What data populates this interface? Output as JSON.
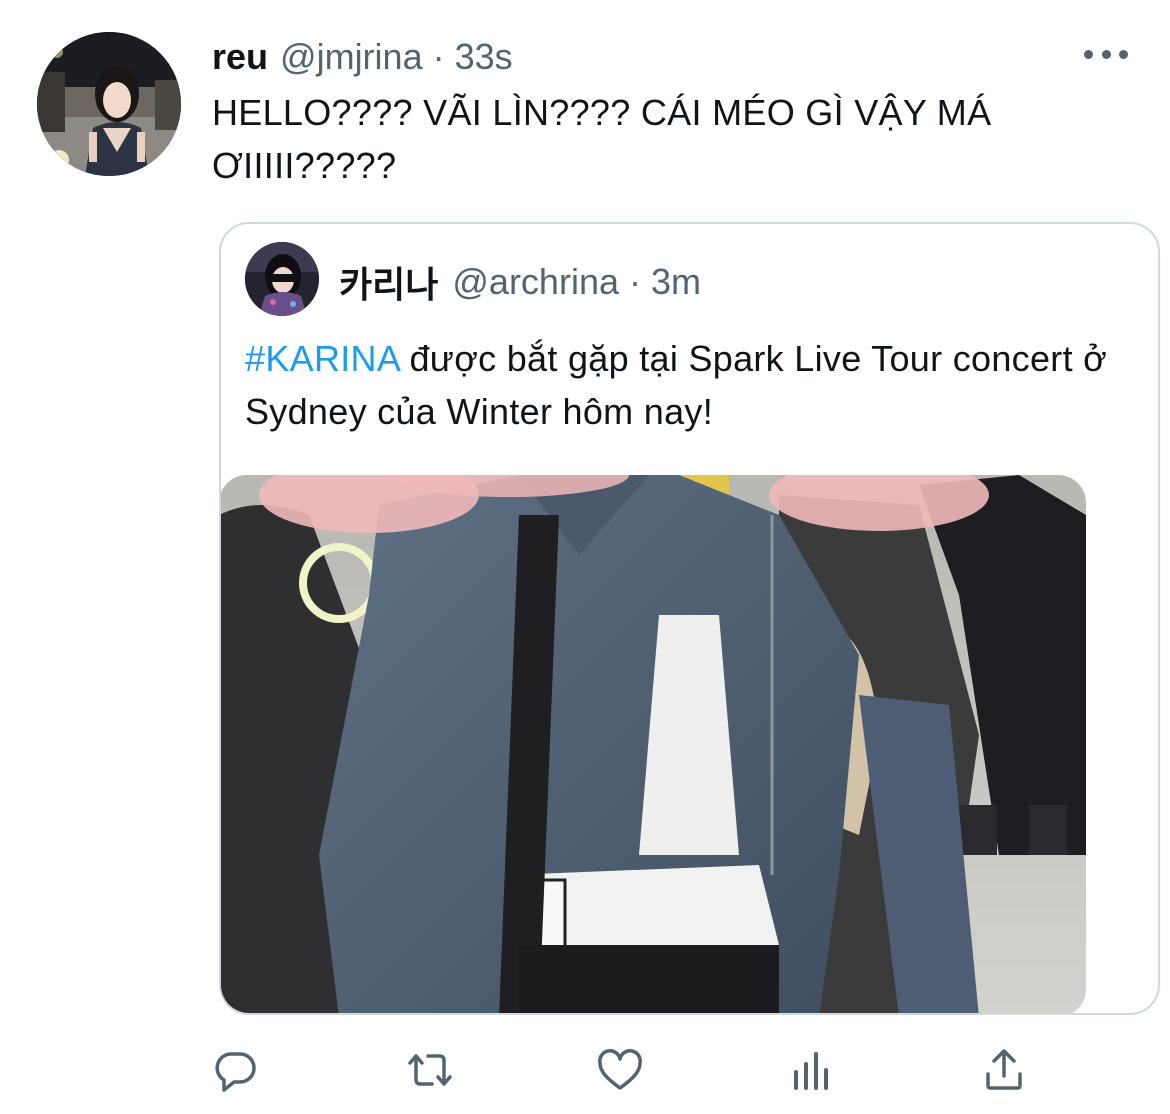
{
  "tweet": {
    "author_name": "reu",
    "author_handle": "@jmjrina",
    "separator": "·",
    "time": "33s",
    "text": "HELLO???? VÃI LÌN???? CÁI MÉO GÌ VẬY MÁ ƠIIIII?????"
  },
  "quote": {
    "author_name": "카리나",
    "author_handle": "@archrina",
    "separator": "·",
    "time": "3m",
    "hashtag": "#KARINA",
    "text_rest": " được bắt gặp tại Spark Live Tour concert ở Sydney của Winter hôm nay!"
  },
  "actions": [
    {
      "icon": "reply-icon"
    },
    {
      "icon": "retweet-icon"
    },
    {
      "icon": "like-icon"
    },
    {
      "icon": "analytics-icon"
    },
    {
      "icon": "share-icon"
    }
  ],
  "colors": {
    "text": "#0f1419",
    "secondary": "#536471",
    "link": "#1d9bf0",
    "border": "#cfd9de"
  }
}
